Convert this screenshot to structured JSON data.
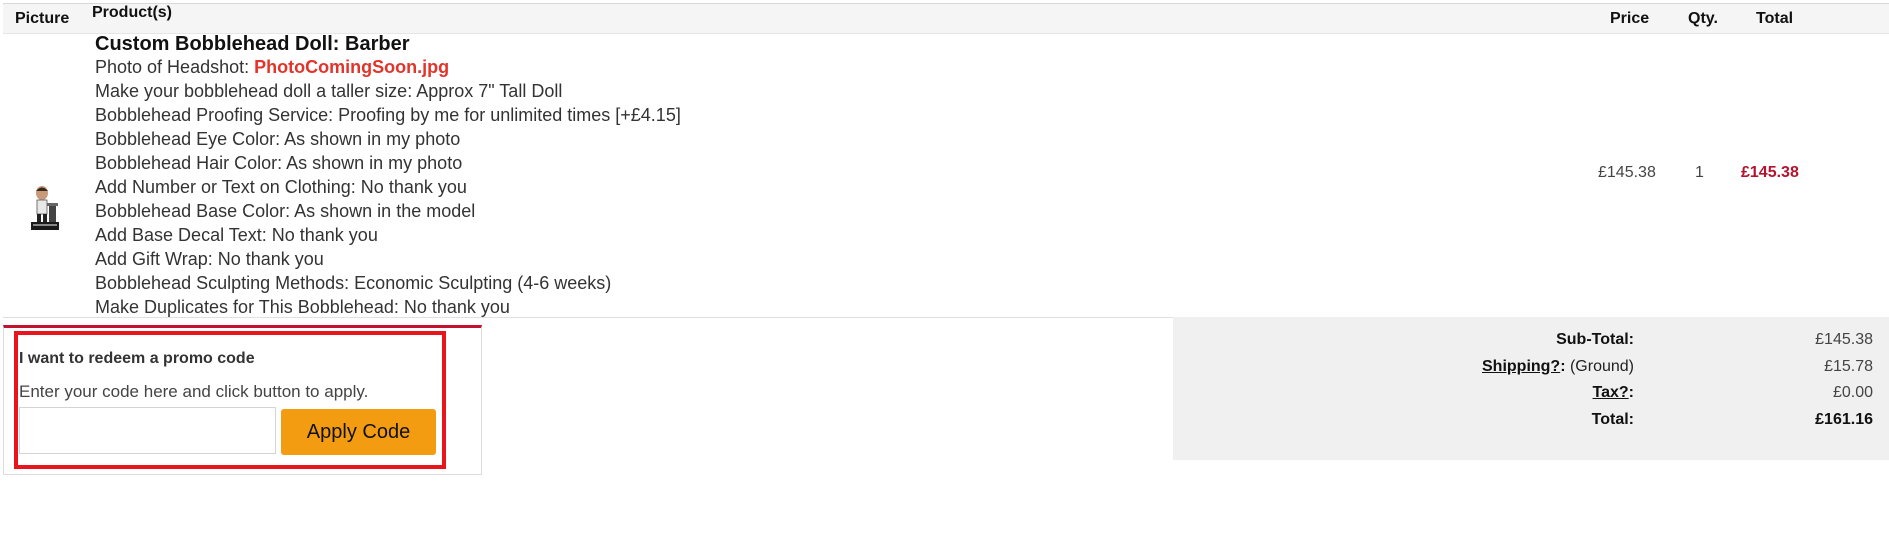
{
  "table_header": {
    "picture": "Picture",
    "products": "Product(s)",
    "price": "Price",
    "qty": "Qty.",
    "total": "Total"
  },
  "item": {
    "thumbnail_icon": "bobblehead-figure-icon",
    "name": "Custom Bobblehead Doll: Barber",
    "headshot_label": "Photo of Headshot: ",
    "headshot_file": "PhotoComingSoon.jpg",
    "options": [
      "Make your bobblehead doll a taller size: Approx 7\" Tall Doll",
      "Bobblehead Proofing Service: Proofing by me for unlimited times [+£4.15]",
      "Bobblehead Eye Color: As shown in my photo",
      "Bobblehead Hair Color: As shown in my photo",
      "Add Number or Text on Clothing: No thank you",
      "Bobblehead Base Color: As shown in the model",
      "Add Base Decal Text: No thank you",
      "Add Gift Wrap: No thank you",
      "Bobblehead Sculpting Methods: Economic Sculpting (4-6 weeks)",
      "Make Duplicates for This Bobblehead: No thank you"
    ],
    "price": "£145.38",
    "qty": "1",
    "total": "£145.38"
  },
  "promo": {
    "title": "I want to redeem a promo code",
    "help": "Enter your code here and click button to apply.",
    "input_value": "",
    "button_label": "Apply Code"
  },
  "totals": {
    "subtotal_label": "Sub-Total:",
    "subtotal_value": "£145.38",
    "shipping_label": "Shipping?",
    "shipping_colon": ":",
    "shipping_note": " (Ground)",
    "shipping_value": "£15.78",
    "tax_label": "Tax?",
    "tax_colon": ":",
    "tax_value": "£0.00",
    "total_label": "Total:",
    "total_value": "£161.16"
  },
  "colors": {
    "accent_red": "#b5122e",
    "link_red": "#e2342a",
    "button_orange": "#f39c12",
    "highlight_outline": "#e8151c"
  }
}
